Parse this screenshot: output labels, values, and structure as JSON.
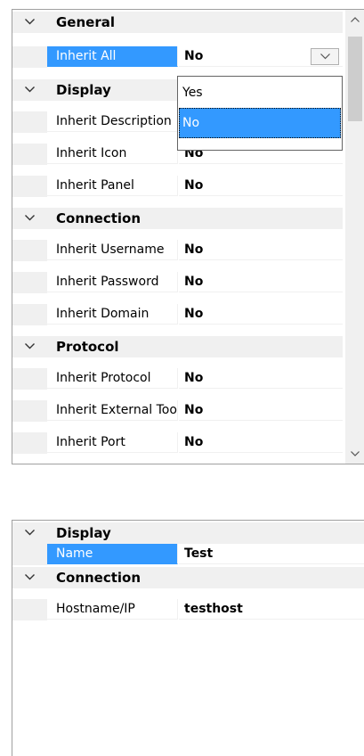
{
  "top_grid": {
    "categories": [
      {
        "label": "General"
      },
      {
        "label": "Display"
      },
      {
        "label": "Connection"
      },
      {
        "label": "Protocol"
      }
    ],
    "properties": [
      {
        "name": "Inherit All",
        "value": "No"
      },
      {
        "name": "Inherit Description",
        "value": "No"
      },
      {
        "name": "Inherit Icon",
        "value": "No"
      },
      {
        "name": "Inherit Panel",
        "value": "No"
      },
      {
        "name": "Inherit Username",
        "value": "No"
      },
      {
        "name": "Inherit Password",
        "value": "No"
      },
      {
        "name": "Inherit Domain",
        "value": "No"
      },
      {
        "name": "Inherit Protocol",
        "value": "No"
      },
      {
        "name": "Inherit External Tool",
        "value": "No"
      },
      {
        "name": "Inherit Port",
        "value": "No"
      }
    ],
    "dropdown": {
      "options": [
        "Yes",
        "No"
      ],
      "selected": "No"
    },
    "icons": {
      "expand": "chevron-down-icon",
      "scroll_up": "scroll-up-arrow-icon",
      "scroll_down": "scroll-down-arrow-icon"
    }
  },
  "bottom_grid": {
    "categories": [
      {
        "label": "Display"
      },
      {
        "label": "Connection"
      }
    ],
    "properties": [
      {
        "name": "Name",
        "value": "Test"
      },
      {
        "name": "Hostname/IP",
        "value": "testhost"
      }
    ]
  },
  "colors": {
    "selection": "#3399ff",
    "category_bg": "#f0f0f0",
    "border": "#a0a0a0"
  }
}
